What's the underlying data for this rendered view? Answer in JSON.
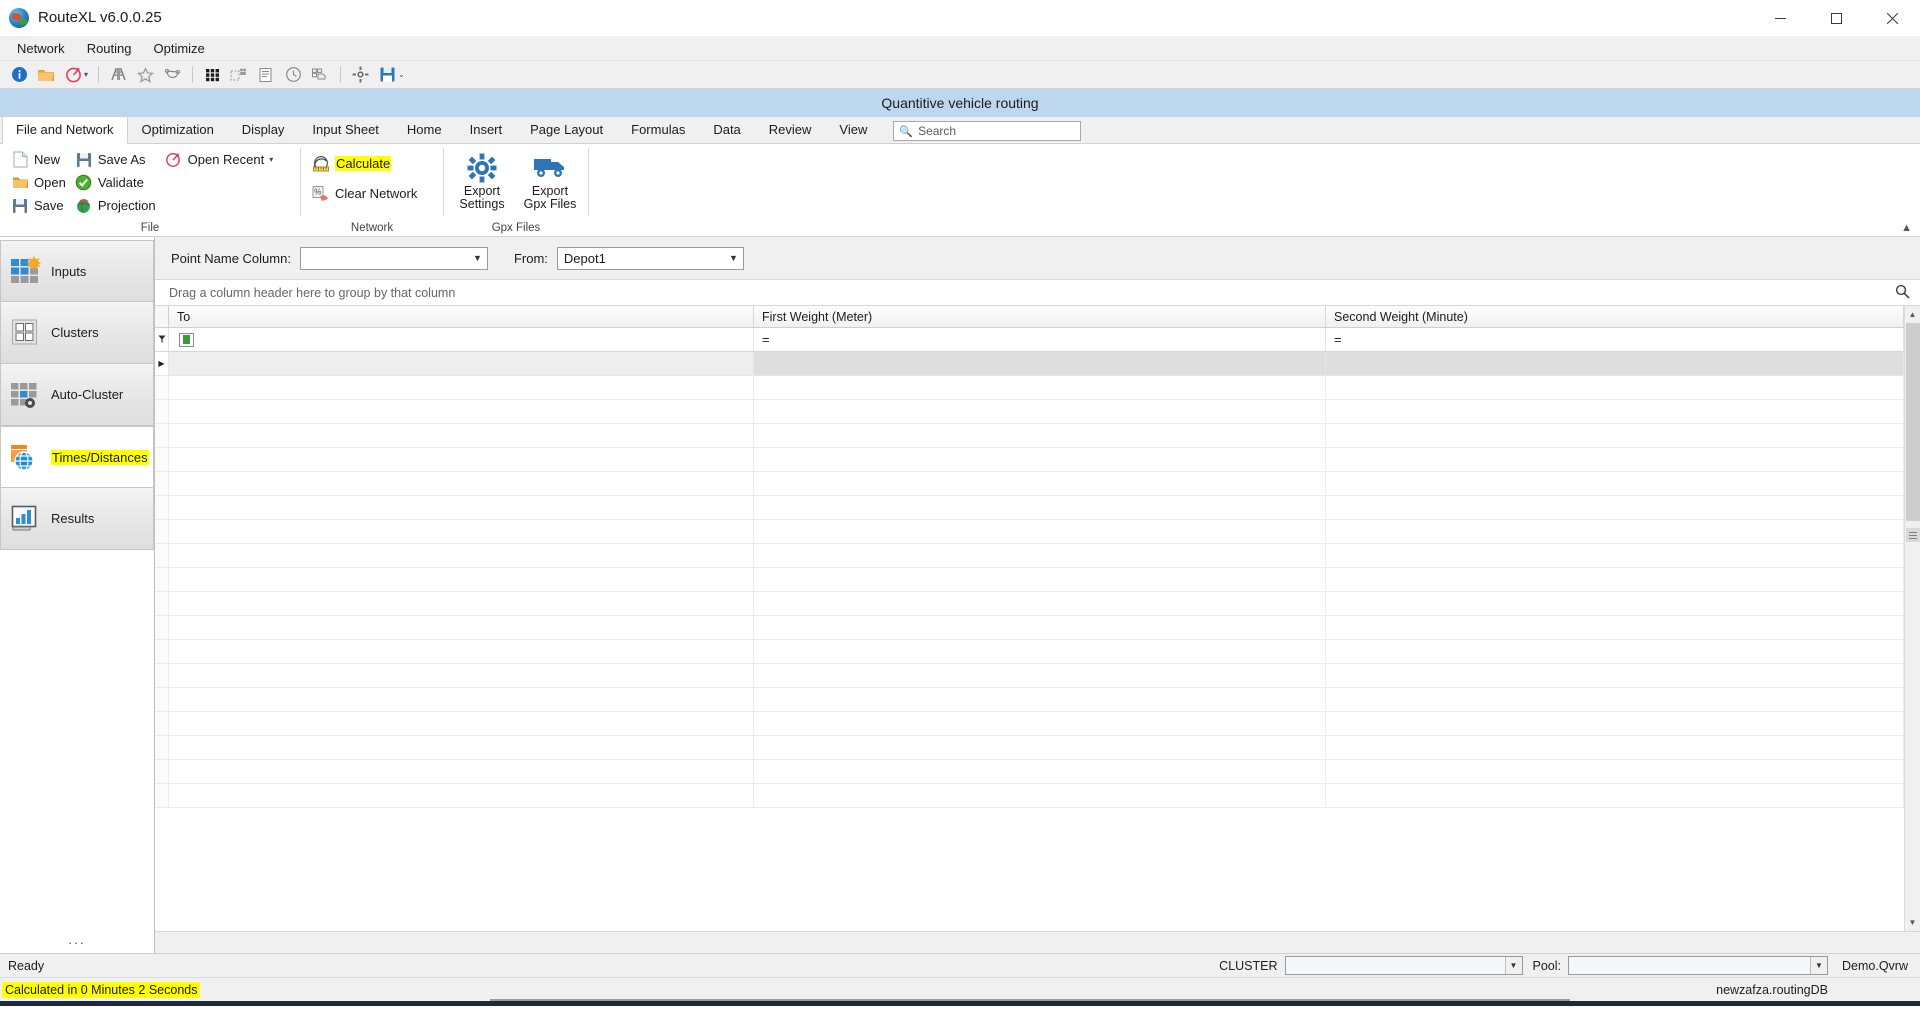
{
  "window": {
    "title": "RouteXL v6.0.0.25",
    "icon": "app-globe-icon",
    "minimize": "minimize-button",
    "maximize": "maximize-button",
    "close": "close-button"
  },
  "menubar": {
    "items": [
      {
        "label": "Network"
      },
      {
        "label": "Routing"
      },
      {
        "label": "Optimize"
      }
    ]
  },
  "quick_toolbar": {
    "buttons": [
      {
        "name": "info-icon"
      },
      {
        "name": "open-folder-icon"
      },
      {
        "name": "speedometer-icon"
      },
      {
        "name": "bridge-icon"
      },
      {
        "name": "star-outline-icon"
      },
      {
        "name": "polygon-node-icon"
      },
      {
        "name": "grid-dots-icon"
      },
      {
        "name": "cluster-map-icon"
      },
      {
        "name": "report-icon"
      },
      {
        "name": "clock-route-icon"
      },
      {
        "name": "truck-list-icon"
      },
      {
        "name": "settings-gear-icon"
      },
      {
        "name": "save-disk-icon"
      },
      {
        "name": "overflow-chevron-icon"
      }
    ]
  },
  "subtitle": "Quantitive vehicle routing",
  "ribbon": {
    "tabs": [
      {
        "label": "File and Network",
        "active": true
      },
      {
        "label": "Optimization",
        "active": false
      },
      {
        "label": "Display",
        "active": false
      },
      {
        "label": "Input Sheet",
        "active": false
      },
      {
        "label": "Home",
        "active": false
      },
      {
        "label": "Insert",
        "active": false
      },
      {
        "label": "Page Layout",
        "active": false
      },
      {
        "label": "Formulas",
        "active": false
      },
      {
        "label": "Data",
        "active": false
      },
      {
        "label": "Review",
        "active": false
      },
      {
        "label": "View",
        "active": false
      }
    ],
    "search_placeholder": "Search",
    "groups": [
      {
        "label": "File",
        "buttons": [
          {
            "label": "New",
            "icon": "new-document-icon"
          },
          {
            "label": "Save As",
            "icon": "save-as-icon"
          },
          {
            "label": "Open",
            "icon": "open-folder-icon"
          },
          {
            "label": "Validate",
            "icon": "validate-check-icon"
          },
          {
            "label": "Open Recent",
            "icon": "open-recent-icon"
          },
          {
            "label": "Save",
            "icon": "save-disk-icon"
          },
          {
            "label": "Projection",
            "icon": "projection-globe-icon"
          }
        ]
      },
      {
        "label": "Network",
        "buttons": [
          {
            "label": "Calculate",
            "icon": "calculate-icon",
            "highlighted": true
          },
          {
            "label": "Clear Network",
            "icon": "clear-network-icon",
            "highlighted": false
          }
        ]
      },
      {
        "label": "Gpx Files",
        "buttons": [
          {
            "label": "Export\nSettings",
            "line1": "Export",
            "line2": "Settings",
            "icon": "gear-icon"
          },
          {
            "label": "Export\nGpx Files",
            "line1": "Export",
            "line2": "Gpx Files",
            "icon": "truck-icon"
          }
        ]
      }
    ],
    "collapse": "collapse-ribbon-icon"
  },
  "sidebar": {
    "items": [
      {
        "label": "Inputs",
        "icon": "inputs-grid-icon",
        "active": false,
        "highlighted": false
      },
      {
        "label": "Clusters",
        "icon": "clusters-grid-icon",
        "active": false,
        "highlighted": false
      },
      {
        "label": "Auto-Cluster",
        "icon": "auto-cluster-icon",
        "active": false,
        "highlighted": false
      },
      {
        "label": "Times/Distances",
        "icon": "times-distances-globe-icon",
        "active": true,
        "highlighted": true
      },
      {
        "label": "Results",
        "icon": "results-chart-icon",
        "active": false,
        "highlighted": false
      }
    ],
    "overflow": "..."
  },
  "toolstrip": {
    "point_name_label": "Point Name Column:",
    "point_name_value": "",
    "from_label": "From:",
    "from_value": "Depot1"
  },
  "grid": {
    "group_hint": "Drag a column header here to group by that column",
    "find_icon": "search-icon",
    "columns": [
      {
        "label": "To"
      },
      {
        "label": "First Weight (Meter)"
      },
      {
        "label": "Second Weight (Minute)"
      }
    ],
    "filter_row": {
      "indicator": "filter-funnel-icon",
      "to_filter": "filter-editor-chip",
      "weight1_operator": "=",
      "weight2_operator": "="
    },
    "rows": [
      {
        "to": "",
        "first_weight": "",
        "second_weight": "",
        "selected": true,
        "indicator": "row-pointer-icon"
      }
    ],
    "scrollbar": {
      "up": "scroll-up-arrow",
      "down": "scroll-down-arrow",
      "grip": "scroll-grip"
    }
  },
  "statusbar": {
    "ready": "Ready",
    "cluster_label": "CLUSTER",
    "cluster_value": "",
    "pool_label": "Pool:",
    "pool_value": "",
    "demo": "Demo.Qvrw"
  },
  "statusbar2": {
    "calculated": "Calculated in 0 Minutes 2 Seconds",
    "database": "newzafza.routingDB"
  },
  "colors": {
    "accent_blue": "#2e75b6",
    "subtitle_bg": "#bdd7ee",
    "highlight_yellow": "#ffff00",
    "chrome_gray": "#f0f0f0"
  }
}
